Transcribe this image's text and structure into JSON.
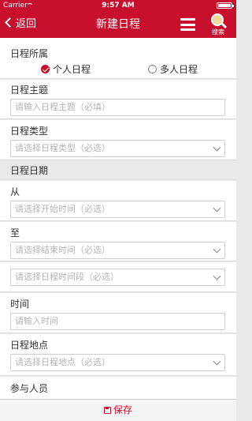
{
  "status_bar": {
    "carrier": "Carrier",
    "time": "9:57 AM"
  },
  "nav": {
    "back_label": "返回",
    "title": "新建日程",
    "search_label": "搜索"
  },
  "form": {
    "owner": {
      "label": "日程所属",
      "options": [
        "个人日程",
        "多人日程"
      ],
      "selected": "个人日程"
    },
    "subject": {
      "label": "日程主题",
      "placeholder": "请输入日程主题（必填）"
    },
    "type": {
      "label": "日程类型",
      "placeholder": "请选择日程类型（必选）"
    },
    "date_group": {
      "label": "日程日期"
    },
    "from": {
      "label": "从",
      "placeholder": "请选择开始时间（必选）"
    },
    "to": {
      "label": "至",
      "placeholder": "请选择结束时间（必选）"
    },
    "period": {
      "placeholder": "请选择日程时间段（必选）"
    },
    "time": {
      "label": "时间",
      "placeholder": "请输入时间"
    },
    "location": {
      "label": "日程地点",
      "placeholder": "请选择日程地点（必选）"
    },
    "participants": {
      "label": "参与人员"
    }
  },
  "bottom": {
    "save_label": "保存"
  },
  "colors": {
    "brand": "#c8102e",
    "background": "#e9e9e9"
  },
  "icons": {
    "back": "chevron-left-icon",
    "menu": "hamburger-menu-icon",
    "search": "search-icon",
    "save": "save-disk-icon",
    "dropdown": "chevron-down-icon"
  }
}
